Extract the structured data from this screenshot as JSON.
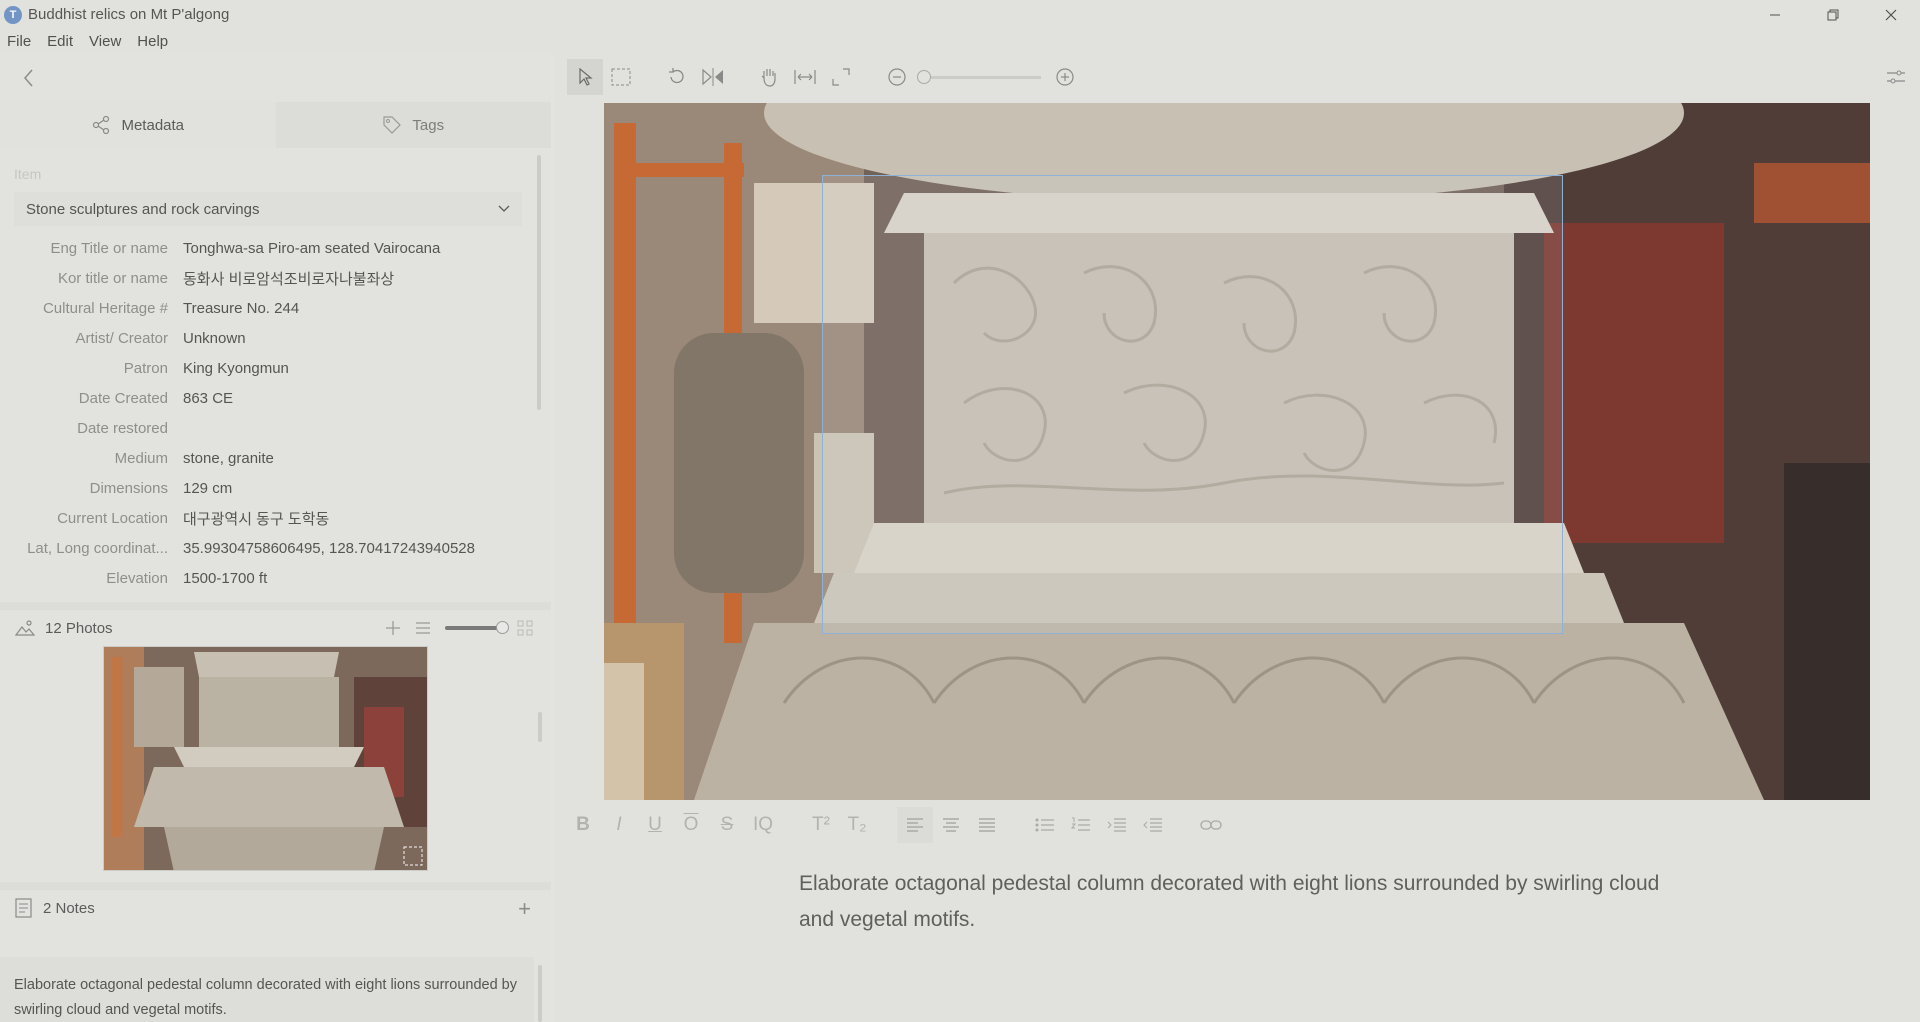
{
  "window": {
    "title": "Buddhist relics on Mt P'algong",
    "logo_icon": "app-logo-icon",
    "controls": [
      "minimize",
      "restore",
      "close"
    ]
  },
  "menu": {
    "items": [
      "File",
      "Edit",
      "View",
      "Help"
    ]
  },
  "left_panel": {
    "tabs": [
      {
        "label": "Metadata",
        "icon": "share-icon",
        "active": true
      },
      {
        "label": "Tags",
        "icon": "tag-icon",
        "active": false
      }
    ],
    "item_label": "Item",
    "item_type": "Stone sculptures and rock carvings",
    "fields": [
      {
        "key": "Eng Title or name",
        "value": "Tonghwa-sa Piro-am seated Vairocana"
      },
      {
        "key": "Kor title or name",
        "value": "동화사 비로암석조비로자나불좌상"
      },
      {
        "key": "Cultural Heritage #",
        "value": "Treasure No. 244"
      },
      {
        "key": "Artist/ Creator",
        "value": "Unknown"
      },
      {
        "key": "Patron",
        "value": "King Kyongmun"
      },
      {
        "key": "Date Created",
        "value": "863 CE"
      },
      {
        "key": "Date restored",
        "value": ""
      },
      {
        "key": "Medium",
        "value": "stone, granite"
      },
      {
        "key": "Dimensions",
        "value": "129 cm"
      },
      {
        "key": "Current Location",
        "value": "대구광역시 동구 도학동"
      },
      {
        "key": "Lat, Long coordinat...",
        "value": "35.99304758606495, 128.70417243940528"
      },
      {
        "key": "Elevation",
        "value": "1500-1700 ft"
      }
    ],
    "photos": {
      "label": "12 Photos",
      "count": 12,
      "thumbnail_size": 0.9
    },
    "notes": {
      "label": "2 Notes",
      "count": 2,
      "note_text": "Elaborate octagonal pedestal column decorated with eight lions surrounded by swirling cloud and vegetal motifs."
    }
  },
  "viewer": {
    "tools": [
      "select-arrow-icon",
      "rectangle-select-icon",
      "rotate-icon",
      "flip-icon",
      "pan-hand-icon",
      "fit-width-icon",
      "fullscreen-icon",
      "zoom-out-icon",
      "zoom-in-icon",
      "settings-sliders-icon"
    ],
    "zoom_level": 0.0
  },
  "editor": {
    "format_buttons": [
      "B",
      "I",
      "U",
      "O",
      "S",
      "IQ",
      "T²",
      "T₂"
    ],
    "text": "Elaborate octagonal pedestal column decorated with eight lions surrounded by swirling cloud and vegetal motifs."
  }
}
